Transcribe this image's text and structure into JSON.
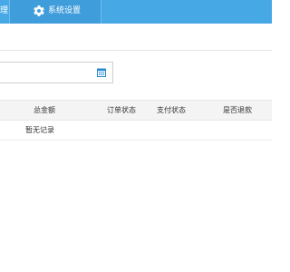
{
  "nav": {
    "partial_label": "理",
    "active_label": "系统设置",
    "bar_color": "#47a8e6"
  },
  "filter": {
    "date_value": "",
    "date_placeholder": ""
  },
  "table": {
    "columns": [
      "总金额",
      "订单状态",
      "支付状态",
      "是否退款"
    ],
    "empty_text": "暂无记录"
  }
}
